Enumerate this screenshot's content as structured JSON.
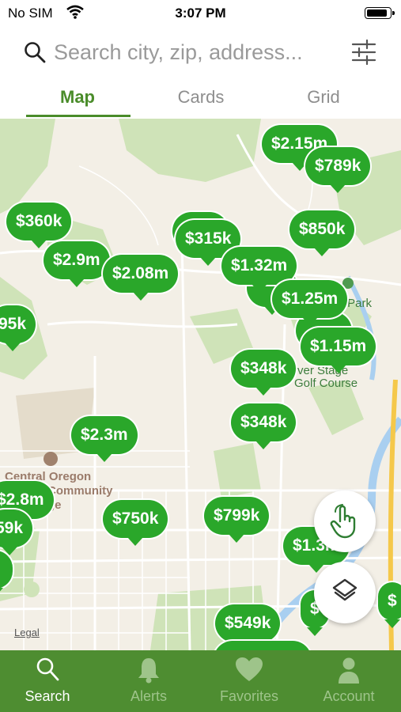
{
  "status_bar": {
    "carrier": "No SIM",
    "time": "3:07 PM",
    "battery_level": 0.95
  },
  "search": {
    "placeholder": "Search city, zip, address..."
  },
  "tabs": [
    {
      "label": "Map",
      "active": true
    },
    {
      "label": "Cards",
      "active": false
    },
    {
      "label": "Grid",
      "active": false
    }
  ],
  "map": {
    "labels": {
      "college": "Central Oregon",
      "community": "Community",
      "college_end": "ge",
      "park": "r Park",
      "golf1": "ver Stage",
      "golf2": "Golf Course",
      "legal": "Legal"
    },
    "pins": [
      "$2.15m",
      "$789k",
      "$360k",
      "$850k",
      "$2.9m",
      "$315k",
      "$2.08m",
      "$1.32m",
      "$1.25m",
      "95k",
      "$1.15m",
      "$348k",
      "$348k",
      "$2.3m",
      "$2.8m",
      "59k",
      "$750k",
      "$799k",
      "$1.3m",
      "$549k",
      "$",
      "$"
    ]
  },
  "colors": {
    "accent": "#4a8c2a",
    "pin": "#2aa72a",
    "nav_bg": "#4e8d31"
  },
  "bottom_nav": [
    {
      "label": "Search",
      "icon": "search-icon",
      "active": true
    },
    {
      "label": "Alerts",
      "icon": "bell-icon",
      "active": false
    },
    {
      "label": "Favorites",
      "icon": "heart-icon",
      "active": false
    },
    {
      "label": "Account",
      "icon": "person-icon",
      "active": false
    }
  ]
}
